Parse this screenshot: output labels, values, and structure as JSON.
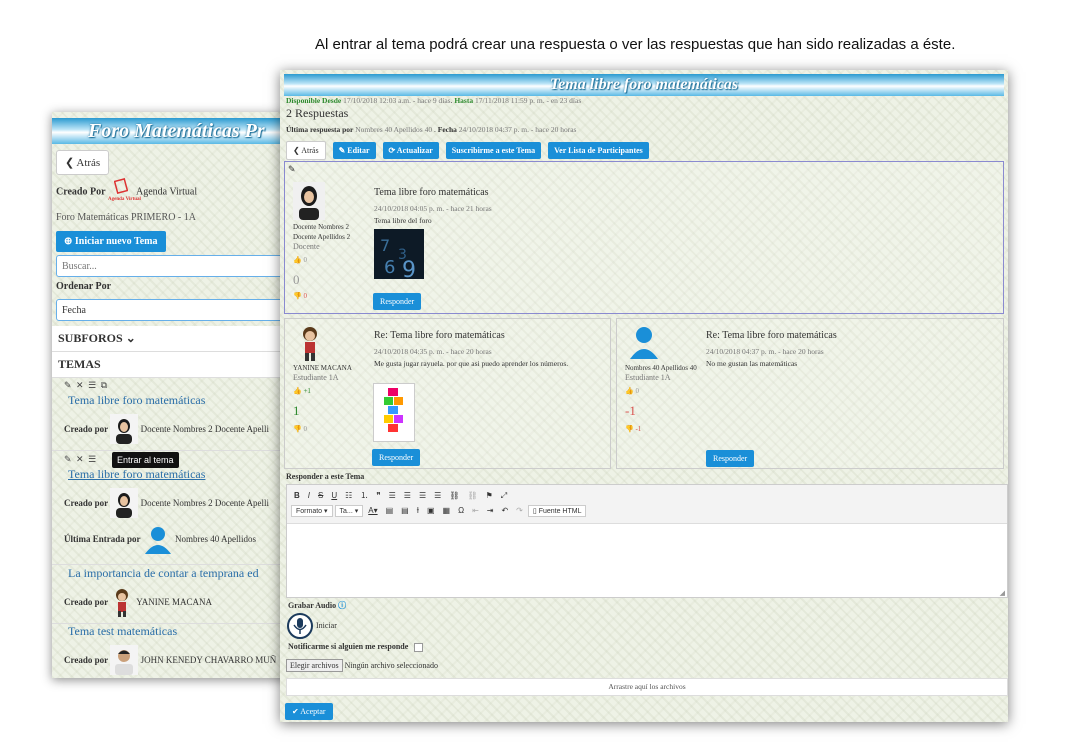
{
  "caption": "Al entrar al tema podrá crear una respuesta o ver las respuestas que han sido realizadas a éste.",
  "back_panel": {
    "banner": "Foro Matemáticas Pr",
    "back_label": "Atrás",
    "created_by_label": "Creado Por",
    "logo_text": "Agenda Virtual",
    "creator": "Agenda Virtual",
    "forum_path": "Foro Matemáticas PRIMERO - 1A",
    "new_topic_label": "Iniciar nuevo Tema",
    "search_placeholder": "Buscar...",
    "order_label": "Ordenar Por",
    "order_value": "Fecha",
    "subforos_label": "SUBFOROS",
    "temas_label": "TEMAS",
    "tooltip": "Entrar al tema",
    "topics": [
      {
        "title": "Tema libre foro matemáticas",
        "created_label": "Creado por",
        "author": "Docente Nombres 2 Docente Apelli"
      },
      {
        "title": "Tema libre foro matemáticas",
        "created_label": "Creado por",
        "author": "Docente Nombres 2 Docente Apelli",
        "last_label": "Última Entrada por",
        "last_author": "Nombres 40 Apellidos"
      },
      {
        "title": "La importancia de contar a temprana ed",
        "created_label": "Creado por",
        "author": "YANINE MACANA"
      },
      {
        "title": "Tema test matemáticas",
        "created_label": "Creado por",
        "author": "JOHN KENEDY CHAVARRO MUÑ"
      }
    ]
  },
  "front_panel": {
    "banner": "Tema libre foro matemáticas",
    "available_from_label": "Disponible Desde",
    "available_from": "17/10/2018 12:03 a.m. - hace 9 días",
    "until_label": "Hasta",
    "until": "17/11/2018 11:59 p. m. - en 23 días",
    "responses_count": "2 Respuestas",
    "last_response_label": "Última respuesta por",
    "last_response_by": "Nombres 40 Apellidos 40",
    "date_label": "Fecha",
    "last_response_date": "24/10/2018 04:37 p. m. - hace 20 horas",
    "toolbar": {
      "back": "Atrás",
      "edit": "Editar",
      "refresh": "Actualizar",
      "subscribe": "Suscribirme a este Tema",
      "participants": "Ver Lista de Participantes"
    },
    "main_post": {
      "author_line1": "Docente Nombres 2",
      "author_line2": "Docente Apellidos 2",
      "role": "Docente",
      "likes": "0",
      "score": "0",
      "dislikes": "0",
      "title": "Tema libre foro matemáticas",
      "date": "24/10/2018 04:05 p. m. - hace 21 horas",
      "text": "Tema libre del foro",
      "reply": "Responder"
    },
    "reply1": {
      "author": "YANINE MACANA",
      "role": "Estudiante 1A",
      "likes": "+1",
      "score": "1",
      "dislikes": "0",
      "title": "Re: Tema libre foro matemáticas",
      "date": "24/10/2018 04:35 p. m. - hace 20 horas",
      "text": "Me gusta jugar rayuela. por que asi puedo aprender los números.",
      "reply": "Responder"
    },
    "reply2": {
      "author": "Nombres 40 Apellidos 40",
      "role": "Estudiante 1A",
      "likes": "0",
      "score": "-1",
      "dislikes": "-1",
      "title": "Re: Tema libre foro matemáticas",
      "date": "24/10/2018 04:37 p. m. - hace 20 horas",
      "text": "No me gustan las matemáticas",
      "reply": "Responder"
    },
    "respond_label": "Responder a este Tema",
    "editor": {
      "format": "Formato",
      "size": "Ta...",
      "source": "Fuente HTML"
    },
    "audio_label": "Grabar Audio",
    "start_label": "Iniciar",
    "notify_label": "Notificarme si alguien me responde",
    "file_button": "Elegir archivos",
    "file_status": "Ningún archivo seleccionado",
    "drop_label": "Arrastre aquí los archivos",
    "accept": "Aceptar"
  },
  "colors": {
    "accent": "#1a8fd8",
    "green": "#2d8a2d",
    "red": "#d9534f"
  }
}
